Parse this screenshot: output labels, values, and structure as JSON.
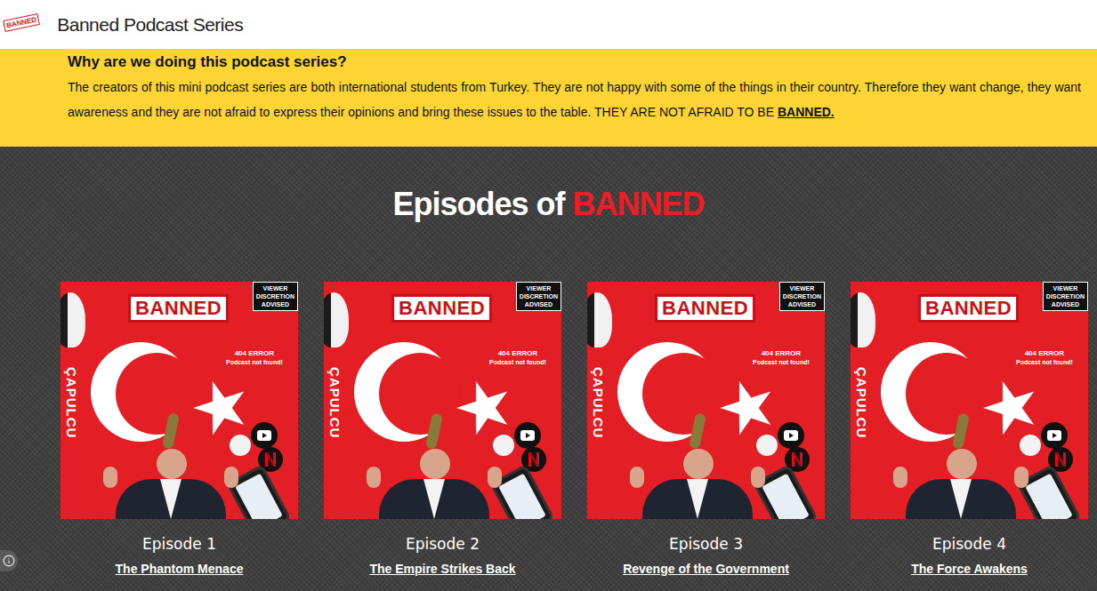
{
  "header": {
    "logo": "BANNED",
    "title": "Banned Podcast Series"
  },
  "intro": {
    "heading": "Why are we doing this podcast series?",
    "body": "The creators of this mini podcast series are both international students from Turkey. They are not happy with some of the things in their country. Therefore they want change, they want awareness and they are not afraid to express their opinions and bring these issues to the table.",
    "shout": "THEY ARE NOT AFRAID TO BE",
    "emphasis": "BANNED."
  },
  "episodes_section": {
    "heading": "Episodes of",
    "heading_highlight": "BANNED"
  },
  "cover": {
    "stamp": "BANNED",
    "warning": [
      "VIEWER",
      "DISCRETION",
      "ADVISED"
    ],
    "error": "404 ERROR",
    "error_note": "Podcast not found!",
    "side": "ÇAPULCU"
  },
  "episodes": [
    {
      "label": "Episode 1",
      "title": "The Phantom Menace"
    },
    {
      "label": "Episode 2",
      "title": "The Empire Strikes Back"
    },
    {
      "label": "Episode 3",
      "title": "Revenge of the Government"
    },
    {
      "label": "Episode 4",
      "title": "The Force Awakens"
    }
  ]
}
